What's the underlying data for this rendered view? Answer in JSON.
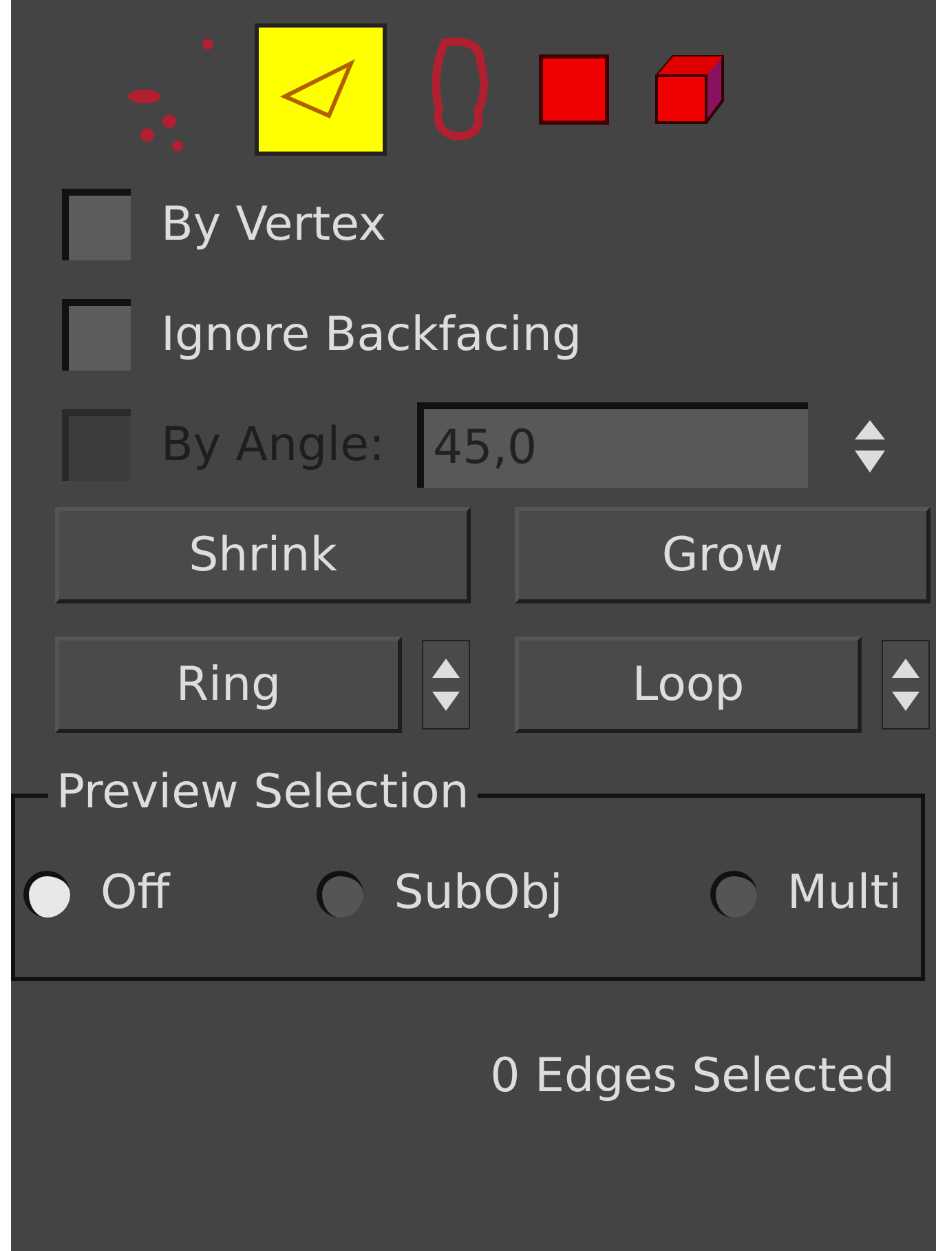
{
  "subobject_levels": [
    {
      "kind": "vertex",
      "selected": false
    },
    {
      "kind": "edge",
      "selected": true
    },
    {
      "kind": "border",
      "selected": false
    },
    {
      "kind": "polygon",
      "selected": false
    },
    {
      "kind": "element",
      "selected": false
    }
  ],
  "options": [
    {
      "label": "By Vertex",
      "checked": false,
      "disabled": false
    },
    {
      "label": "Ignore Backfacing",
      "checked": false,
      "disabled": false
    },
    {
      "label": "By Angle:",
      "checked": false,
      "disabled": true,
      "value": "45,0"
    }
  ],
  "buttons": [
    {
      "label": "Shrink"
    },
    {
      "label": "Grow"
    }
  ],
  "spinner_buttons": [
    {
      "label": "Ring"
    },
    {
      "label": "Loop"
    }
  ],
  "preview_selection": {
    "title": "Preview Selection",
    "options": [
      {
        "label": "Off",
        "selected": true
      },
      {
        "label": "SubObj",
        "selected": false
      },
      {
        "label": "Multi",
        "selected": false
      }
    ]
  },
  "status": "0 Edges Selected"
}
